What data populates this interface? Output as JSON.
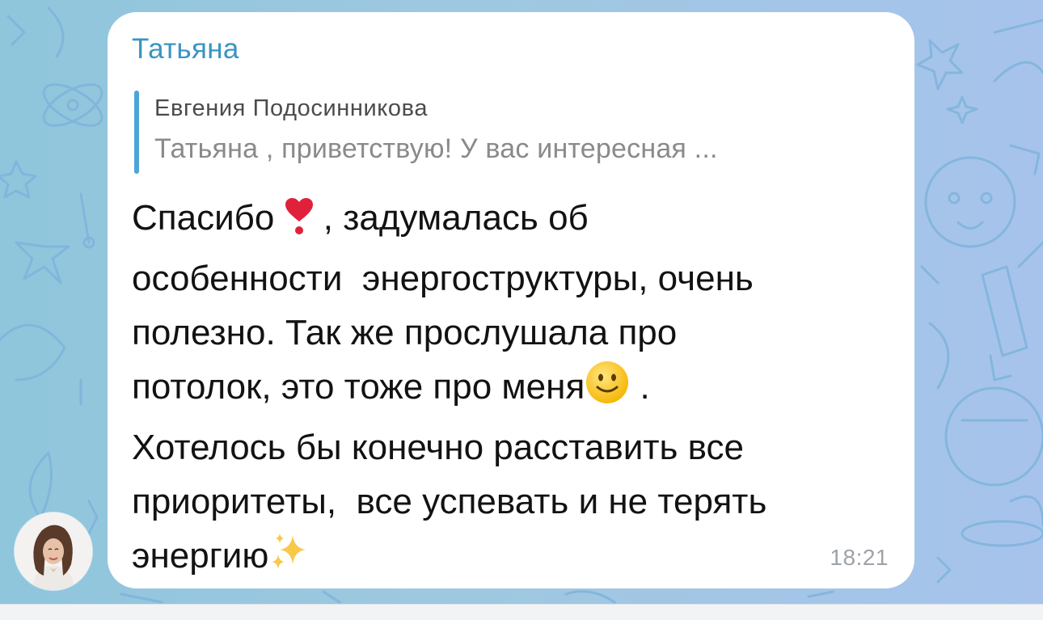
{
  "colors": {
    "accent": "#3b93c3",
    "reply_bar": "#4ca5d6",
    "bubble_bg": "#ffffff",
    "wallpaper": "#9ec8e0"
  },
  "message": {
    "sender_name": "Татьяна",
    "reply": {
      "author": "Евгения Подосинникова",
      "text": "Татьяна , приветствую! У вас интересная ..."
    },
    "body": {
      "line1_a": "Спасибо",
      "line1_b": " , задумалась об",
      "line2": "особенности  энергоструктуры, очень",
      "line3": "полезно. Так же прослушала про",
      "line4_a": "потолок, это тоже про меня",
      "line4_b": " .",
      "line5": "Хотелось бы конечно расставить все",
      "line6": "приоритеты,  все успевать и не терять",
      "line7": "энергию"
    },
    "emojis": [
      "heavy-heart-exclamation-icon",
      "slightly-smiling-face-icon",
      "sparkles-icon"
    ],
    "time": "18:21"
  },
  "avatar": {
    "icon": "user-avatar-photo"
  }
}
